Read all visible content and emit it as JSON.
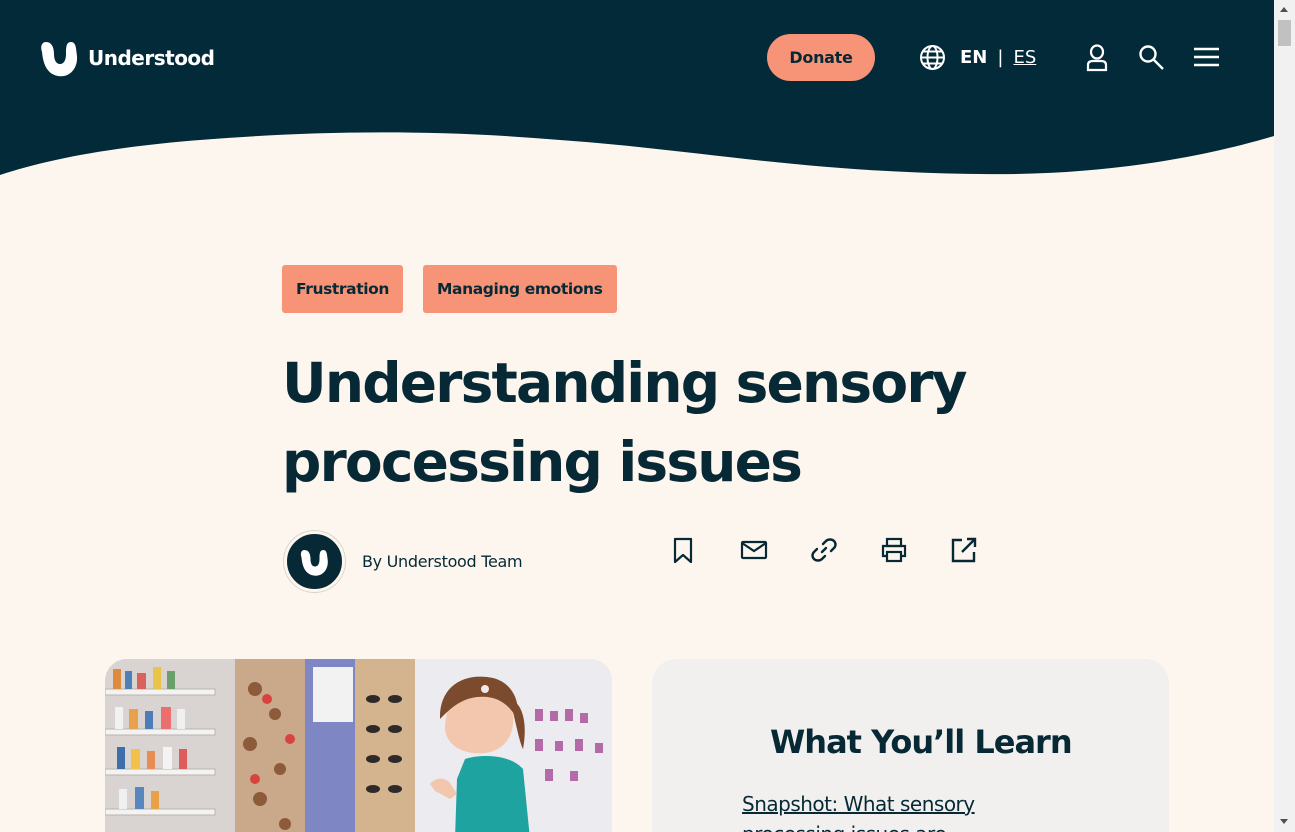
{
  "header": {
    "logo_text": "Understood",
    "donate_label": "Donate",
    "lang_en": "EN",
    "lang_separator": "|",
    "lang_es": "ES",
    "background_color": "#032a38",
    "accent_color": "#f79478"
  },
  "article": {
    "tags": [
      "Frustration",
      "Managing emotions"
    ],
    "title_line1": "Understanding sensory",
    "title_line2": "processing issues",
    "byline": "By Understood Team"
  },
  "share_icons": [
    "bookmark-icon",
    "email-icon",
    "link-icon",
    "print-icon",
    "share-external-icon"
  ],
  "learn_card": {
    "title": "What You’ll Learn",
    "first_link_line1": "Snapshot: What sensory",
    "first_link_line2": "processing issues are"
  }
}
